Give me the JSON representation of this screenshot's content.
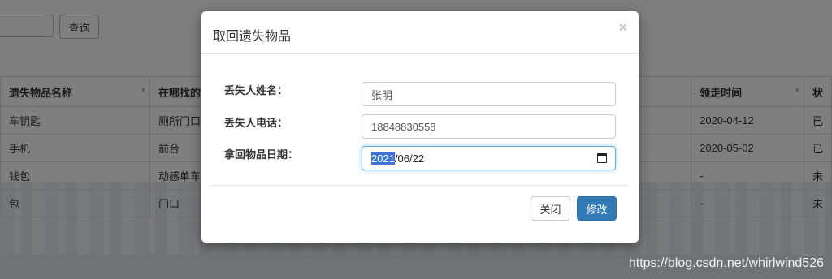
{
  "background": {
    "search_button": "查询",
    "columns": [
      "遗失物品名称",
      "在哪找的",
      "领走时间",
      "状"
    ],
    "rows": [
      {
        "name": "车钥匙",
        "location": "厕所门口",
        "time": "2020-04-12",
        "status": "已"
      },
      {
        "name": "手机",
        "location": "前台",
        "time": "2020-05-02",
        "status": "已"
      },
      {
        "name": "钱包",
        "location": "动感单车",
        "time": "-",
        "status": "未"
      },
      {
        "name": "包",
        "location": "门口",
        "time": "-",
        "status": "未"
      }
    ]
  },
  "modal": {
    "title": "取回遗失物品",
    "close": "×",
    "fields": {
      "name_label": "丢失人姓名：",
      "name_value": "张明",
      "phone_label": "丢失人电话：",
      "phone_value": "18848830558",
      "date_label": "拿回物品日期：",
      "date_year": "2021",
      "date_rest": "/06/22"
    },
    "buttons": {
      "close": "关闭",
      "submit": "修改"
    }
  },
  "watermark": "https://blog.csdn.net/whirlwind526"
}
